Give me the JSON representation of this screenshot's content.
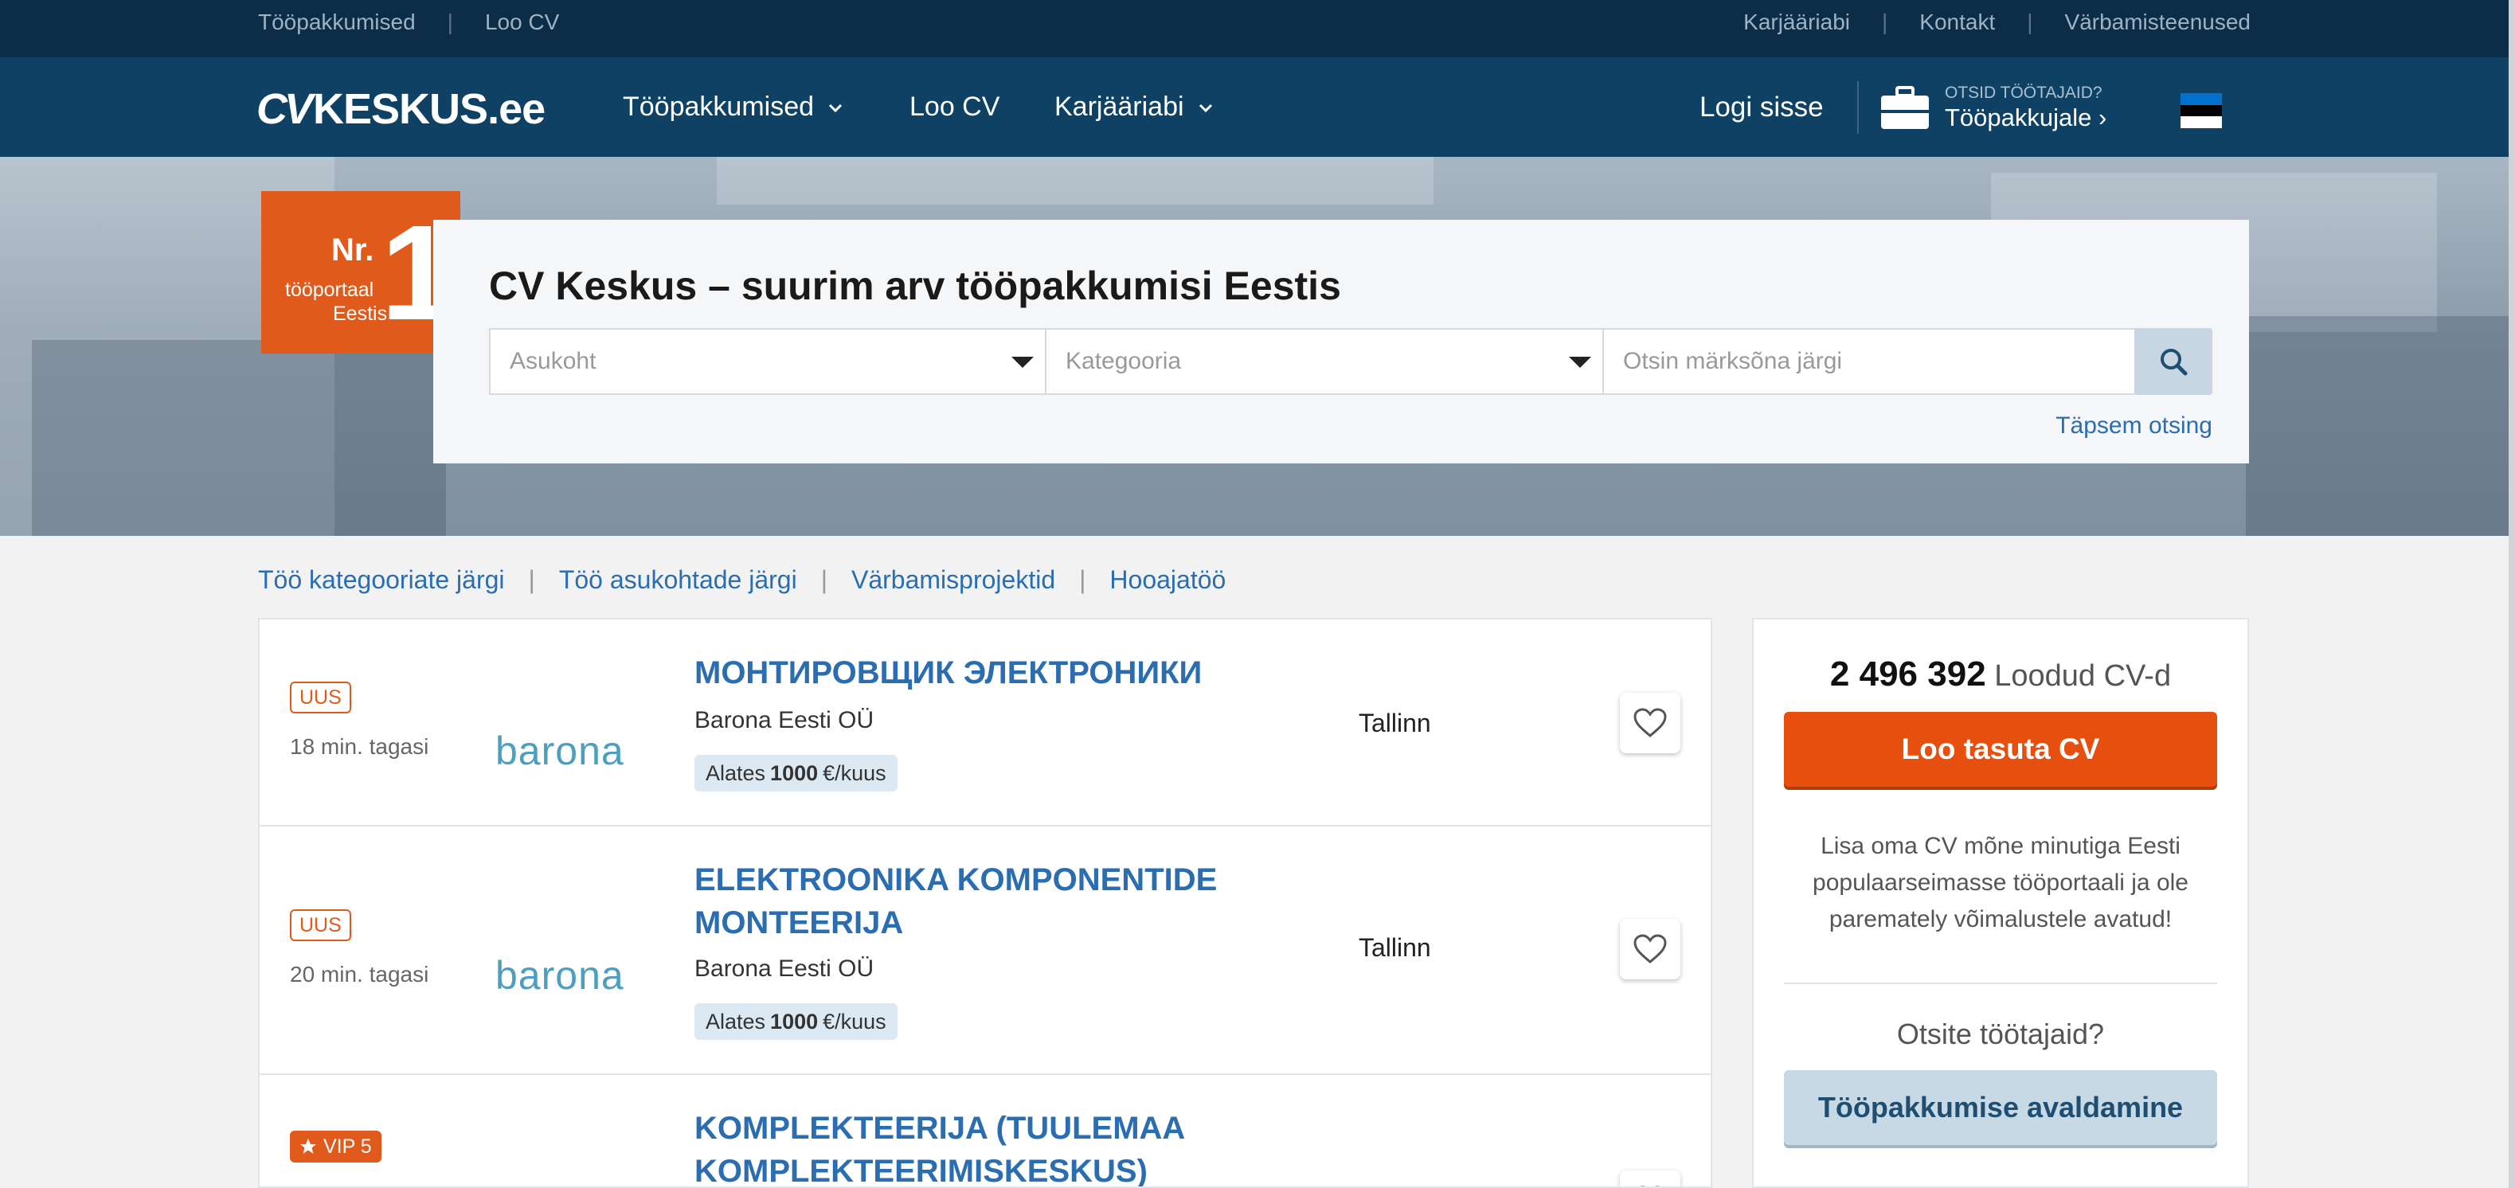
{
  "topbar": {
    "left_links": [
      "Tööpakkumised",
      "Loo CV"
    ],
    "right_links": [
      "Karjääriabi",
      "Kontakt",
      "Värbamisteenused"
    ]
  },
  "nav": {
    "logo_cv": "CV",
    "logo_main": "KESKUS",
    "logo_tld": ".ee",
    "items": [
      {
        "label": "Tööpakkumised",
        "dropdown": true
      },
      {
        "label": "Loo CV",
        "dropdown": false
      },
      {
        "label": "Karjääriabi",
        "dropdown": true
      }
    ],
    "login": "Logi sisse",
    "employer_small": "OTSID TÖÖTAJAID?",
    "employer_big": "Tööpakkujale ›",
    "flag_colors": [
      "#0072ce",
      "#000000",
      "#ffffff"
    ]
  },
  "hero": {
    "badge": {
      "nr": "Nr.",
      "one": "1",
      "line1": "tööportaal",
      "line2": "Eestis"
    },
    "title": "CV Keskus – suurim arv tööpakkumisi Eestis",
    "location_placeholder": "Asukoht",
    "category_placeholder": "Kategooria",
    "keyword_placeholder": "Otsin märksõna järgi",
    "advanced_search": "Täpsem otsing"
  },
  "subnav": [
    "Töö kategooriate järgi",
    "Töö asukohtade järgi",
    "Värbamisprojektid",
    "Hooajatöö"
  ],
  "jobs": [
    {
      "tag": "UUS",
      "ago": "18 min. tagasi",
      "logo_text": "barona",
      "title": "МОНТИРОВЩИК ЭЛЕКТРОНИКИ",
      "company": "Barona Eesti OÜ",
      "salary_prefix": "Alates",
      "salary_value": "1000",
      "salary_unit": "€/kuus",
      "city": "Tallinn"
    },
    {
      "tag": "UUS",
      "ago": "20 min. tagasi",
      "logo_text": "barona",
      "title": "ELEKTROONIKA KOMPONENTIDE MONTEERIJA",
      "company": "Barona Eesti OÜ",
      "salary_prefix": "Alates",
      "salary_value": "1000",
      "salary_unit": "€/kuus",
      "city": "Tallinn"
    },
    {
      "tag": "VIP 5",
      "title": "KOMPLEKTEERIJA (TUULEMAA KOMPLEKTEERIMISKESKUS)"
    }
  ],
  "sidebar": {
    "count": "2 496 392",
    "count_label": "Loodud CV-d",
    "cta": "Loo tasuta CV",
    "text": "Lisa oma CV mõne minutiga Eesti populaarseimasse tööportaali ja ole paremately võimalustele avatud!",
    "question": "Otsite töötajaid?",
    "employer_button": "Tööpakkumise avaldamine"
  },
  "colors": {
    "topbar": "#0b2d48",
    "nav": "#0f4165",
    "accent_orange": "#e05a1c",
    "link_blue": "#2a6db0"
  }
}
